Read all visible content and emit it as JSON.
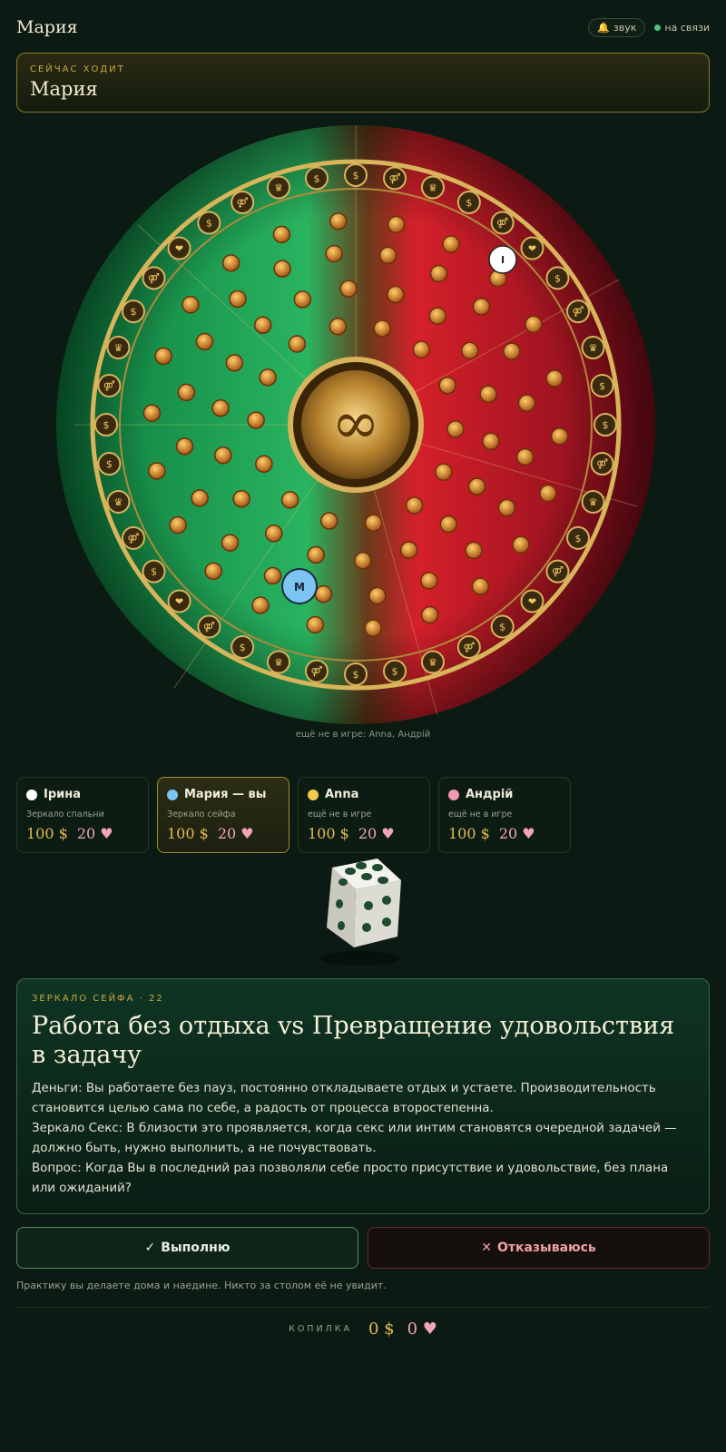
{
  "header": {
    "title": "Мария",
    "sound_label": "звук",
    "status_label": "на связи"
  },
  "turn": {
    "label": "СЕЙЧАС ХОДИТ",
    "name": "Мария"
  },
  "board": {
    "center_symbol": "∞",
    "tokens": [
      {
        "label": "I",
        "color": "#ffffff"
      },
      {
        "label": "M",
        "color": "#7cc4f2"
      }
    ],
    "not_in_game_caption": "ещё не в игре: Anna, Андрій"
  },
  "players": [
    {
      "name": "Ірина",
      "status": "Зеркало спальни",
      "money": "100 $",
      "hearts": "20",
      "color": "#ffffff",
      "active": false
    },
    {
      "name": "Мария — вы",
      "status": "Зеркало сейфа",
      "money": "100 $",
      "hearts": "20",
      "color": "#7cc4f2",
      "active": true
    },
    {
      "name": "Anna",
      "status": "ещё не в игре",
      "money": "100 $",
      "hearts": "20",
      "color": "#f2c94c",
      "active": false
    },
    {
      "name": "Андрій",
      "status": "ещё не в игре",
      "money": "100 $",
      "hearts": "20",
      "color": "#f29ab2",
      "active": false
    }
  ],
  "card": {
    "kicker": "ЗЕРКАЛО СЕЙФА · 22",
    "title": "Работа без отдыха vs Превращение удовольствия в задачу",
    "line_money": "Деньги: Вы работаете без пауз, постоянно откладываете отдых и устаете. Производительность становится целью сама по себе, а радость от процесса второстепенна.",
    "line_mirror": "Зеркало Секс: В близости это проявляется, когда секс или интим становятся очередной задачей — должно быть, нужно выполнить, а не почувствовать.",
    "line_question": "Вопрос: Когда Вы в последний раз позволяли себе просто присутствие и удовольствие, без плана или ожиданий?"
  },
  "actions": {
    "accept": "Выполню",
    "refuse": "Отказываюсь",
    "note": "Практику вы делаете дома и наедине. Никто за столом её не увидит."
  },
  "bank": {
    "label": "КОПИЛКА",
    "money": "0 $",
    "hearts": "0"
  }
}
